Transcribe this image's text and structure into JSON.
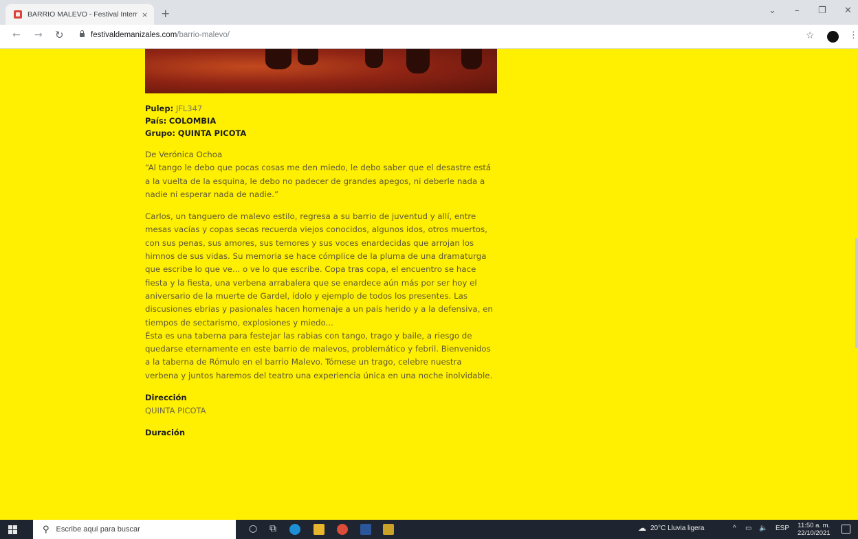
{
  "browser": {
    "tab_title": "BARRIO MALEVO - Festival Intern",
    "tab_close": "×",
    "new_tab": "+",
    "url_domain": "festivaldemanizales.com",
    "url_path": "/barrio-malevo/"
  },
  "info": {
    "pulep_label": "Pulep:",
    "pulep_value": "JFL347",
    "pais_label": "País:",
    "pais_value": "COLOMBIA",
    "grupo_label": "Grupo:",
    "grupo_value": "QUINTA PICOTA"
  },
  "synopsis": {
    "author": "De Verónica Ochoa",
    "quote": "“Al tango le debo que pocas cosas me den miedo, le debo saber que el desastre está a la vuelta de la esquina, le debo no padecer de grandes apegos, ni deberle nada a nadie ni esperar nada de nadie.”",
    "body": "Carlos, un tanguero de malevo estilo, regresa a su barrio de juventud y allí, entre mesas vacías y copas secas recuerda viejos conocidos, algunos idos, otros muertos, con sus penas, sus amores, sus temores y sus voces enardecidas que arrojan los himnos de sus vidas. Su memoria se hace cómplice de la pluma de una dramaturga que escribe lo que ve... o ve lo que escribe. Copa tras copa, el encuentro se hace fiesta y la fiesta, una verbena arrabalera que se enardece aún más por ser hoy el aniversario de la muerte de Gardel, ídolo y ejemplo de todos los presentes. Las discusiones ebrias y pasionales hacen homenaje a un país herido y a la defensiva, en tiempos de sectarismo, explosiones y miedo...",
    "body2": "Ésta es una taberna para festejar las rabias con tango, trago y baile, a riesgo de quedarse eternamente en este barrio de malevos, problemático y febril. Bienvenidos a la taberna de Rómulo en el barrio Malevo. Tómese un trago, celebre nuestra verbena y juntos haremos del teatro una experiencia única en una noche inolvidable."
  },
  "direccion": {
    "heading": "Dirección",
    "value": "QUINTA PICOTA"
  },
  "duracion": {
    "heading": "Duración"
  },
  "taskbar": {
    "search_placeholder": "Escribe aquí para buscar",
    "weather": "20°C  Lluvia ligera",
    "lang": "ESP",
    "time": "11:50 a. m.",
    "date": "22/10/2021"
  },
  "colors": {
    "page_bg": "#ffef00",
    "taskbar_bg": "#1f2530"
  }
}
